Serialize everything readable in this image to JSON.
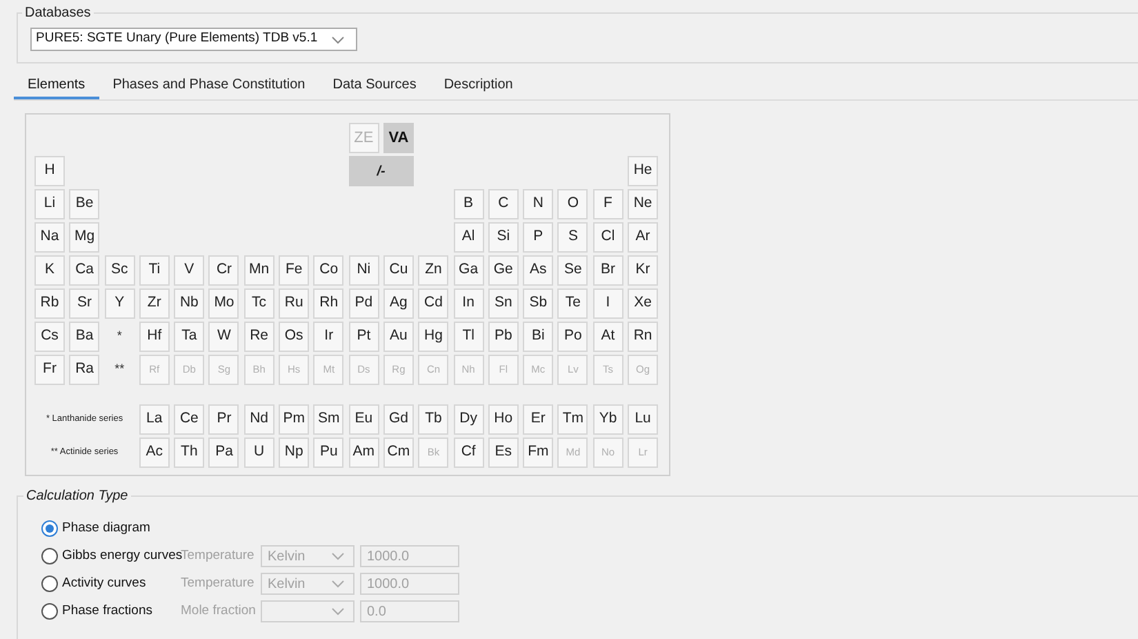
{
  "databases": {
    "legend": "Databases",
    "selected_database": "PURE5: SGTE Unary (Pure Elements) TDB v5.1"
  },
  "tabs": [
    {
      "label": "Elements",
      "selected": true
    },
    {
      "label": "Phases and Phase Constitution",
      "selected": false
    },
    {
      "label": "Data Sources",
      "selected": false
    },
    {
      "label": "Description",
      "selected": false
    }
  ],
  "specials": [
    {
      "symbol": "ZE",
      "disabled": true,
      "selected": false
    },
    {
      "symbol": "VA",
      "disabled": false,
      "selected": true
    }
  ],
  "charge": {
    "symbol": "/-",
    "selected": true
  },
  "periods": [
    {
      "left": [
        {
          "symbol": "H",
          "disabled": false
        }
      ],
      "right": [
        {
          "symbol": "He",
          "disabled": false
        }
      ]
    },
    {
      "left": [
        {
          "symbol": "Li",
          "disabled": false
        },
        {
          "symbol": "Be",
          "disabled": false
        }
      ],
      "right": [
        {
          "symbol": "B",
          "disabled": false
        },
        {
          "symbol": "C",
          "disabled": false
        },
        {
          "symbol": "N",
          "disabled": false
        },
        {
          "symbol": "O",
          "disabled": false
        },
        {
          "symbol": "F",
          "disabled": false
        },
        {
          "symbol": "Ne",
          "disabled": false
        }
      ]
    },
    {
      "left": [
        {
          "symbol": "Na",
          "disabled": false
        },
        {
          "symbol": "Mg",
          "disabled": false
        }
      ],
      "right": [
        {
          "symbol": "Al",
          "disabled": false
        },
        {
          "symbol": "Si",
          "disabled": false
        },
        {
          "symbol": "P",
          "disabled": false
        },
        {
          "symbol": "S",
          "disabled": false
        },
        {
          "symbol": "Cl",
          "disabled": false
        },
        {
          "symbol": "Ar",
          "disabled": false
        }
      ]
    },
    {
      "left": [
        {
          "symbol": "K",
          "disabled": false
        },
        {
          "symbol": "Ca",
          "disabled": false
        },
        {
          "symbol": "Sc",
          "disabled": false
        },
        {
          "symbol": "Ti",
          "disabled": false
        },
        {
          "symbol": "V",
          "disabled": false
        },
        {
          "symbol": "Cr",
          "disabled": false
        },
        {
          "symbol": "Mn",
          "disabled": false
        },
        {
          "symbol": "Fe",
          "disabled": false
        },
        {
          "symbol": "Co",
          "disabled": false
        },
        {
          "symbol": "Ni",
          "disabled": false
        },
        {
          "symbol": "Cu",
          "disabled": false
        },
        {
          "symbol": "Zn",
          "disabled": false
        },
        {
          "symbol": "Ga",
          "disabled": false
        },
        {
          "symbol": "Ge",
          "disabled": false
        },
        {
          "symbol": "As",
          "disabled": false
        },
        {
          "symbol": "Se",
          "disabled": false
        },
        {
          "symbol": "Br",
          "disabled": false
        },
        {
          "symbol": "Kr",
          "disabled": false
        }
      ]
    },
    {
      "left": [
        {
          "symbol": "Rb",
          "disabled": false
        },
        {
          "symbol": "Sr",
          "disabled": false
        },
        {
          "symbol": "Y",
          "disabled": false
        },
        {
          "symbol": "Zr",
          "disabled": false
        },
        {
          "symbol": "Nb",
          "disabled": false
        },
        {
          "symbol": "Mo",
          "disabled": false
        },
        {
          "symbol": "Tc",
          "disabled": false
        },
        {
          "symbol": "Ru",
          "disabled": false
        },
        {
          "symbol": "Rh",
          "disabled": false
        },
        {
          "symbol": "Pd",
          "disabled": false
        },
        {
          "symbol": "Ag",
          "disabled": false
        },
        {
          "symbol": "Cd",
          "disabled": false
        },
        {
          "symbol": "In",
          "disabled": false
        },
        {
          "symbol": "Sn",
          "disabled": false
        },
        {
          "symbol": "Sb",
          "disabled": false
        },
        {
          "symbol": "Te",
          "disabled": false
        },
        {
          "symbol": "I",
          "disabled": false
        },
        {
          "symbol": "Xe",
          "disabled": false
        }
      ]
    },
    {
      "left": [
        {
          "symbol": "Cs",
          "disabled": false
        },
        {
          "symbol": "Ba",
          "disabled": false
        },
        {
          "symbol": "*",
          "kind": "marker"
        },
        {
          "symbol": "Hf",
          "disabled": false
        },
        {
          "symbol": "Ta",
          "disabled": false
        },
        {
          "symbol": "W",
          "disabled": false
        },
        {
          "symbol": "Re",
          "disabled": false
        },
        {
          "symbol": "Os",
          "disabled": false
        },
        {
          "symbol": "Ir",
          "disabled": false
        },
        {
          "symbol": "Pt",
          "disabled": false
        },
        {
          "symbol": "Au",
          "disabled": false
        },
        {
          "symbol": "Hg",
          "disabled": false
        },
        {
          "symbol": "Tl",
          "disabled": false
        },
        {
          "symbol": "Pb",
          "disabled": false
        },
        {
          "symbol": "Bi",
          "disabled": false
        },
        {
          "symbol": "Po",
          "disabled": false
        },
        {
          "symbol": "At",
          "disabled": false
        },
        {
          "symbol": "Rn",
          "disabled": false
        }
      ]
    },
    {
      "left": [
        {
          "symbol": "Fr",
          "disabled": false
        },
        {
          "symbol": "Ra",
          "disabled": false
        },
        {
          "symbol": "**",
          "kind": "marker"
        },
        {
          "symbol": "Rf",
          "disabled": true
        },
        {
          "symbol": "Db",
          "disabled": true
        },
        {
          "symbol": "Sg",
          "disabled": true
        },
        {
          "symbol": "Bh",
          "disabled": true
        },
        {
          "symbol": "Hs",
          "disabled": true
        },
        {
          "symbol": "Mt",
          "disabled": true
        },
        {
          "symbol": "Ds",
          "disabled": true
        },
        {
          "symbol": "Rg",
          "disabled": true
        },
        {
          "symbol": "Cn",
          "disabled": true
        },
        {
          "symbol": "Nh",
          "disabled": true
        },
        {
          "symbol": "Fl",
          "disabled": true
        },
        {
          "symbol": "Mc",
          "disabled": true
        },
        {
          "symbol": "Lv",
          "disabled": true
        },
        {
          "symbol": "Ts",
          "disabled": true
        },
        {
          "symbol": "Og",
          "disabled": true
        }
      ]
    }
  ],
  "series": [
    {
      "label": "* Lanthanide series",
      "elements": [
        {
          "symbol": "La",
          "disabled": false
        },
        {
          "symbol": "Ce",
          "disabled": false
        },
        {
          "symbol": "Pr",
          "disabled": false
        },
        {
          "symbol": "Nd",
          "disabled": false
        },
        {
          "symbol": "Pm",
          "disabled": false
        },
        {
          "symbol": "Sm",
          "disabled": false
        },
        {
          "symbol": "Eu",
          "disabled": false
        },
        {
          "symbol": "Gd",
          "disabled": false
        },
        {
          "symbol": "Tb",
          "disabled": false
        },
        {
          "symbol": "Dy",
          "disabled": false
        },
        {
          "symbol": "Ho",
          "disabled": false
        },
        {
          "symbol": "Er",
          "disabled": false
        },
        {
          "symbol": "Tm",
          "disabled": false
        },
        {
          "symbol": "Yb",
          "disabled": false
        },
        {
          "symbol": "Lu",
          "disabled": false
        }
      ]
    },
    {
      "label": "** Actinide series",
      "elements": [
        {
          "symbol": "Ac",
          "disabled": false
        },
        {
          "symbol": "Th",
          "disabled": false
        },
        {
          "symbol": "Pa",
          "disabled": false
        },
        {
          "symbol": "U",
          "disabled": false
        },
        {
          "symbol": "Np",
          "disabled": false
        },
        {
          "symbol": "Pu",
          "disabled": false
        },
        {
          "symbol": "Am",
          "disabled": false
        },
        {
          "symbol": "Cm",
          "disabled": false
        },
        {
          "symbol": "Bk",
          "disabled": true
        },
        {
          "symbol": "Cf",
          "disabled": false
        },
        {
          "symbol": "Es",
          "disabled": false
        },
        {
          "symbol": "Fm",
          "disabled": false
        },
        {
          "symbol": "Md",
          "disabled": true
        },
        {
          "symbol": "No",
          "disabled": true
        },
        {
          "symbol": "Lr",
          "disabled": true
        }
      ]
    }
  ],
  "calculation_type": {
    "legend": "Calculation Type",
    "options": [
      {
        "label": "Phase diagram",
        "selected": true
      },
      {
        "label": "Gibbs energy curves",
        "selected": false,
        "parameter": "Temperature",
        "unit": "Kelvin",
        "value": "1000.0"
      },
      {
        "label": "Activity curves",
        "selected": false,
        "parameter": "Temperature",
        "unit": "Kelvin",
        "value": "1000.0"
      },
      {
        "label": "Phase fractions",
        "selected": false,
        "parameter": "Mole fraction",
        "value": "0.0"
      }
    ]
  }
}
